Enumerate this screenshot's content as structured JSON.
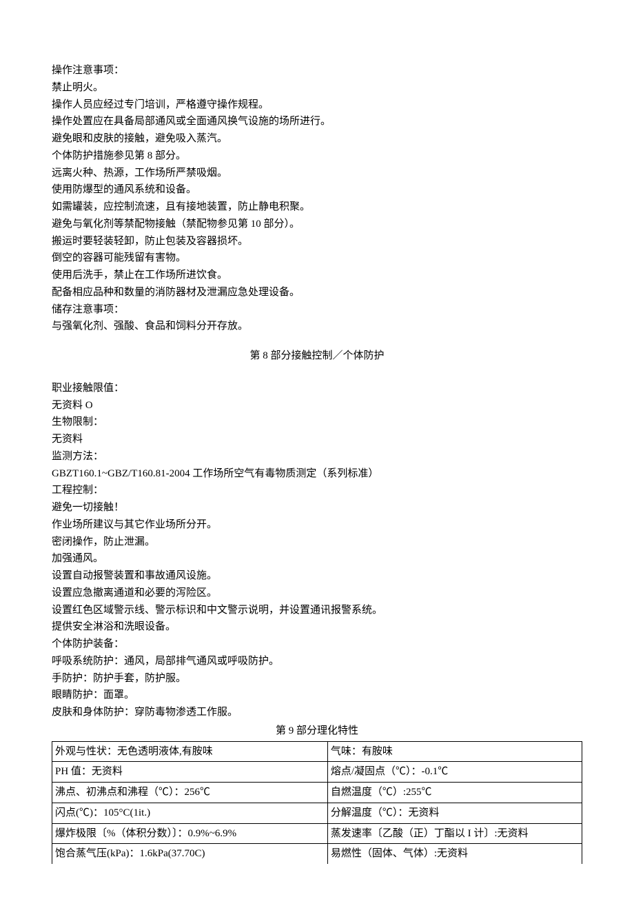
{
  "ops_title": "操作注意事项：",
  "ops": [
    "禁止明火。",
    "操作人员应经过专门培训，严格遵守操作规程。",
    "操作处置应在具备局部通风或全面通风换气设施的场所进行。",
    "避免眼和皮肤的接触，避免吸入蒸汽。",
    "个体防护措施参见第 8 部分。",
    "远离火种、热源，工作场所严禁吸烟。",
    "使用防爆型的通风系统和设备。",
    "如需罐装，应控制流速，且有接地装置，防止静电积聚。",
    "避免与氧化剂等禁配物接触（禁配物参见第 10 部分）。",
    "搬运时要轻装轻卸，防止包装及容器损坏。",
    "倒空的容器可能残留有害物。",
    "使用后洗手，禁止在工作场所进饮食。",
    "配备相应品种和数量的消防器材及泄漏应急处理设备。"
  ],
  "storage_title": "储存注意事项：",
  "storage": [
    "与强氧化剂、强酸、食品和饲料分开存放。"
  ],
  "section8_title": "第 8 部分接触控制／个体防护",
  "s8_limits_title": "职业接触限值：",
  "s8_limits_val": "无资料 O",
  "s8_bio_title": "生物限制：",
  "s8_bio_val": "无资料",
  "s8_monitor_title": "监测方法：",
  "s8_monitor_val": "GBZT160.1~GBZ/T160.81-2004 工作场所空气有毒物质测定（系列标准）",
  "s8_eng_title": "工程控制：",
  "s8_eng": [
    "避免一切接触！",
    "作业场所建议与其它作业场所分开。",
    "密闭操作，防止泄漏。",
    "加强通风。",
    "设置自动报警装置和事故通风设施。",
    "设置应急撤离通道和必要的泻险区。",
    "设置红色区域警示线、警示标识和中文警示说明，并设置通讯报警系统。",
    "提供安全淋浴和洗眼设备。"
  ],
  "s8_ppe_title": "个体防护装备：",
  "s8_ppe": [
    "呼吸系统防护：通风，局部排气通风或呼吸防护。",
    "手防护：防护手套，防护服。",
    "眼睛防护：面罩。",
    "皮肤和身体防护：穿防毒物渗透工作服。"
  ],
  "section9_title": "第 9 部分理化特性",
  "table": [
    {
      "l": "外观与性状：无色透明液体,有胺味",
      "r": "气味：有胺味"
    },
    {
      "l": "PH 值：无资料",
      "r": "熔点/凝固点（℃）：-0.1℃"
    },
    {
      "l": "沸点、初沸点和沸程（℃）：256℃",
      "r": "自燃温度（℃）:255℃"
    },
    {
      "l": "闪点(℃)：105°C(1it.)",
      "r": "分解温度（℃）：无资料"
    },
    {
      "l": "爆炸极限〔%（体积分数）〕：0.9%~6.9%",
      "r": "蒸发速率〔乙酸（正）丁酯以 I 计〕:无资料"
    },
    {
      "l": "饱合蒸气压(kPa)：1.6kPa(37.70C)",
      "r": "易燃性（固体、气体）:无资料"
    }
  ]
}
